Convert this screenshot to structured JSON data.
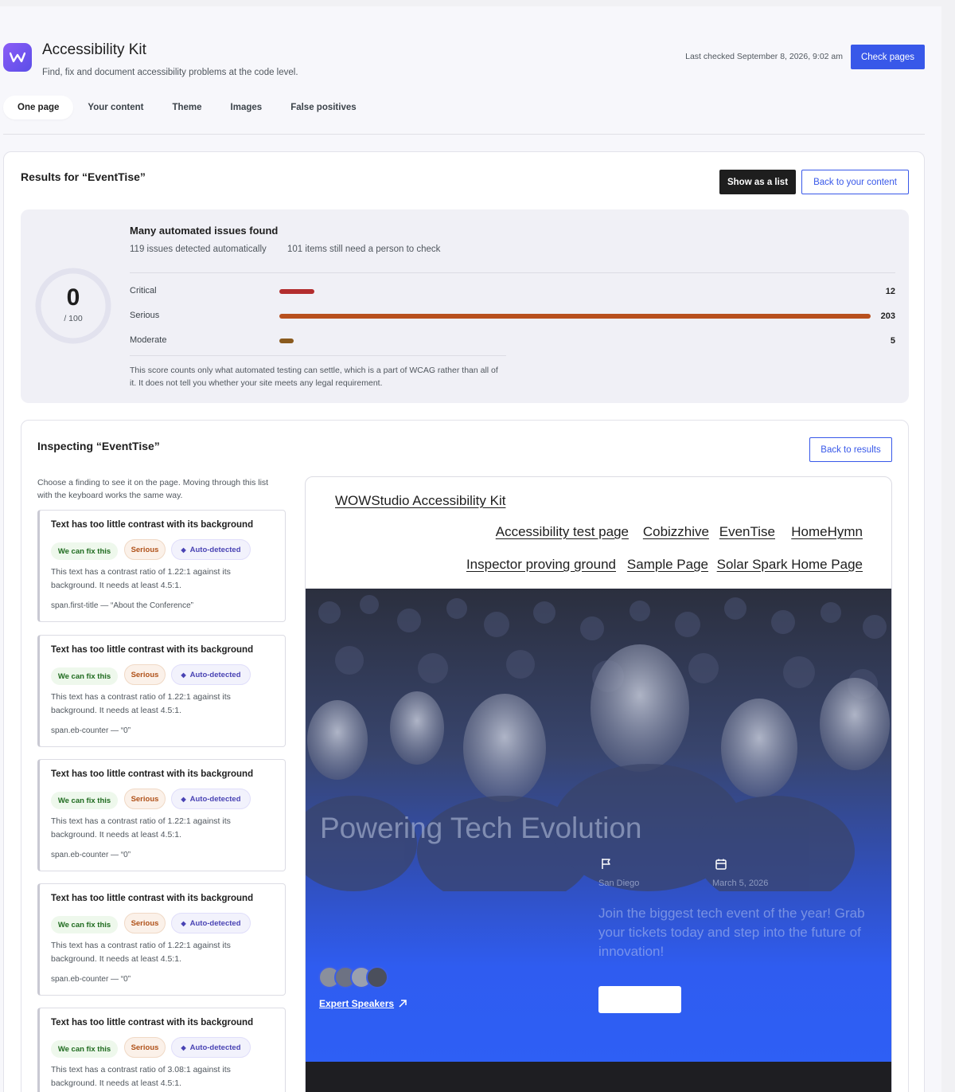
{
  "app": {
    "title": "Accessibility Kit",
    "subtitle": "Find, fix and document accessibility problems at the code level.",
    "last_checked": "Last checked September 8, 2026, 9:02 am",
    "check_button": "Check pages",
    "accent_color": "#3858e9"
  },
  "tabs": [
    {
      "label": "One page",
      "active": true
    },
    {
      "label": "Your content",
      "active": false
    },
    {
      "label": "Theme",
      "active": false
    },
    {
      "label": "Images",
      "active": false
    },
    {
      "label": "False positives",
      "active": false
    }
  ],
  "results": {
    "title": "Results for “EventTise”",
    "show_list_button": "Show as a list",
    "back_content_button": "Back to your content",
    "score": "0",
    "score_max": "/ 100",
    "score_fraction": 0,
    "issues_title": "Many automated issues found",
    "auto_detected": "119 issues detected automatically",
    "need_check": "101 items still need a person to check",
    "severities": [
      {
        "label": "Critical",
        "count": "12",
        "value": 12,
        "color": "#b32d2e"
      },
      {
        "label": "Serious",
        "count": "203",
        "value": 203,
        "color": "#b8501e"
      },
      {
        "label": "Moderate",
        "count": "5",
        "value": 5,
        "color": "#8a5a1e"
      }
    ],
    "note": "This score counts only what automated testing can settle, which is a part of WCAG rather than all of it. It does not tell you whether your site meets any legal requirement."
  },
  "inspect": {
    "title": "Inspecting “EventTise”",
    "back_results_button": "Back to results",
    "help": "Choose a finding to see it on the page. Moving through this list with the keyboard works the same way.",
    "findings": [
      {
        "title": "Text has too little contrast with its background",
        "fix": "We can fix this",
        "severity": "Serious",
        "auto": "Auto-detected",
        "desc": "This text has a contrast ratio of 1.22:1 against its background. It needs at least 4.5:1.",
        "selector": "span.first-title — “About the Conference”"
      },
      {
        "title": "Text has too little contrast with its background",
        "fix": "We can fix this",
        "severity": "Serious",
        "auto": "Auto-detected",
        "desc": "This text has a contrast ratio of 1.22:1 against its background. It needs at least 4.5:1.",
        "selector": "span.eb-counter — “0”"
      },
      {
        "title": "Text has too little contrast with its background",
        "fix": "We can fix this",
        "severity": "Serious",
        "auto": "Auto-detected",
        "desc": "This text has a contrast ratio of 1.22:1 against its background. It needs at least 4.5:1.",
        "selector": "span.eb-counter — “0”"
      },
      {
        "title": "Text has too little contrast with its background",
        "fix": "We can fix this",
        "severity": "Serious",
        "auto": "Auto-detected",
        "desc": "This text has a contrast ratio of 1.22:1 against its background. It needs at least 4.5:1.",
        "selector": "span.eb-counter — “0”"
      },
      {
        "title": "Text has too little contrast with its background",
        "fix": "We can fix this",
        "severity": "Serious",
        "auto": "Auto-detected",
        "desc": "This text has a contrast ratio of 3.08:1 against its background. It needs at least 4.5:1.",
        "selector": ""
      }
    ]
  },
  "preview": {
    "site_title": "WOWStudio Accessibility Kit",
    "nav": [
      "Accessibility test page",
      "Cobizzhive",
      "EvenTise",
      "HomeHymn",
      "Inspector proving ground",
      "Sample Page",
      "Solar Spark Home Page"
    ],
    "hero_title": "Powering Tech Evolution",
    "location": "San Diego",
    "date": "March 5, 2026",
    "hero_text": "Join the biggest tech event of the year! Grab your tickets today and step into the future of innovation!",
    "speakers_link": "Expert Speakers"
  }
}
